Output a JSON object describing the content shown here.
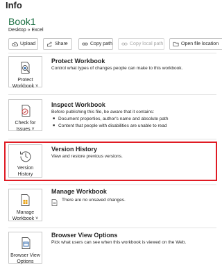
{
  "header": {
    "title": "Info"
  },
  "document": {
    "name": "Book1",
    "path": "Desktop » Excel"
  },
  "actions": {
    "upload": "Upload",
    "share": "Share",
    "copy_path": "Copy path",
    "copy_local_path": "Copy local path",
    "open_file_location": "Open file location"
  },
  "sections": {
    "protect": {
      "tile_line1": "Protect",
      "tile_line2": "Workbook ˅",
      "title": "Protect Workbook",
      "description": "Control what types of changes people can make to this workbook."
    },
    "inspect": {
      "tile_line1": "Check for",
      "tile_line2": "Issues ˅",
      "title": "Inspect Workbook",
      "description": "Before publishing this file, be aware that it contains:",
      "bullets": [
        "Document properties, author's name and absolute path",
        "Content that people with disabilities are unable to read"
      ]
    },
    "version": {
      "tile_line1": "Version",
      "tile_line2": "History",
      "title": "Version History",
      "description": "View and restore previous versions."
    },
    "manage": {
      "tile_line1": "Manage",
      "tile_line2": "Workbook ˅",
      "title": "Manage Workbook",
      "description": "There are no unsaved changes."
    },
    "browser": {
      "tile_line1": "Browser View",
      "tile_line2": "Options",
      "title": "Browser View Options",
      "description": "Pick what users can see when this workbook is viewed on the Web."
    }
  },
  "colors": {
    "accent": "#1e7145",
    "highlight": "#e01b24",
    "border": "#c8c8c8"
  }
}
